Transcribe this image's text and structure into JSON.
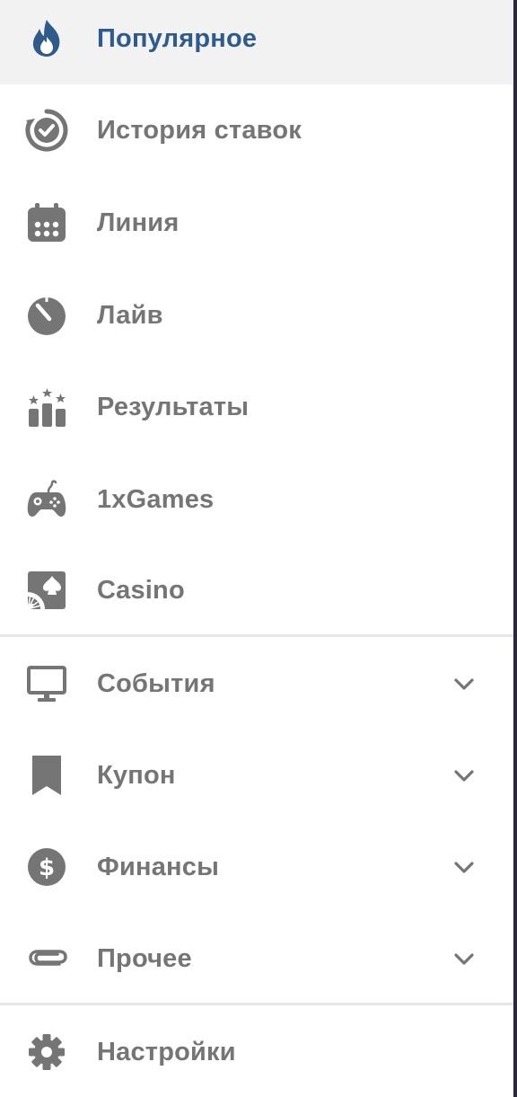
{
  "colors": {
    "accent": "#2e5a8c",
    "icon": "#757575",
    "text": "#757575",
    "active_background": "#f2f2f2",
    "divider": "#e6e6e6"
  },
  "menu": {
    "primary": [
      {
        "label": "Популярное",
        "icon": "flame-icon",
        "active": true
      },
      {
        "label": "История ставок",
        "icon": "history-check-icon"
      },
      {
        "label": "Линия",
        "icon": "calendar-icon"
      },
      {
        "label": "Лайв",
        "icon": "stopwatch-icon"
      },
      {
        "label": "Результаты",
        "icon": "results-podium-icon"
      },
      {
        "label": "1xGames",
        "icon": "gamepad-icon"
      },
      {
        "label": "Casino",
        "icon": "casino-spade-icon"
      }
    ],
    "expandable": [
      {
        "label": "События",
        "icon": "monitor-icon"
      },
      {
        "label": "Купон",
        "icon": "bookmark-icon"
      },
      {
        "label": "Финансы",
        "icon": "dollar-coin-icon"
      },
      {
        "label": "Прочее",
        "icon": "paperclip-icon"
      }
    ],
    "footer": [
      {
        "label": "Настройки",
        "icon": "gear-icon"
      }
    ]
  }
}
